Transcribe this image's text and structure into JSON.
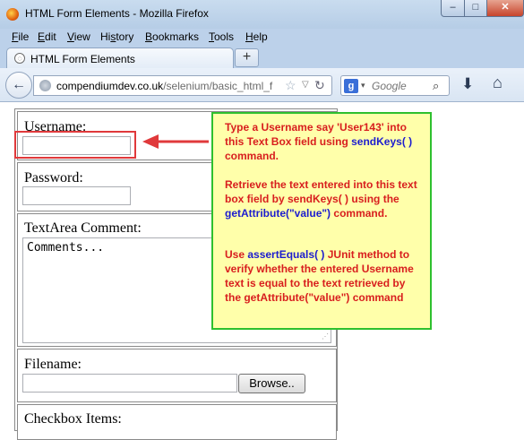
{
  "window": {
    "title": "HTML Form Elements - Mozilla Firefox",
    "min_label": "–",
    "max_label": "□",
    "close_label": "✕"
  },
  "menu": {
    "items": [
      {
        "accel": "F",
        "rest": "ile"
      },
      {
        "accel": "E",
        "rest": "dit"
      },
      {
        "accel": "V",
        "rest": "iew"
      },
      {
        "accel": "",
        "pre": "Hi",
        "accel2": "s",
        "rest": "tory"
      },
      {
        "accel": "B",
        "rest": "ookmarks"
      },
      {
        "accel": "T",
        "rest": "ools"
      },
      {
        "accel": "H",
        "rest": "elp"
      }
    ]
  },
  "tabs": {
    "active_title": "HTML Form Elements",
    "new_tab_label": "+"
  },
  "nav": {
    "back_icon": "←",
    "url_domain": "compendiumdev.co.uk",
    "url_path": "/selenium/basic_html_f",
    "star_icon": "☆",
    "dropdown_icon": "▽",
    "reload_icon": "↻",
    "search_engine_icon": "g",
    "search_dropdown_icon": "▾",
    "search_placeholder": "Google",
    "search_icon": "⌕",
    "download_icon": "⬇",
    "home_icon": "⌂"
  },
  "form": {
    "username_label": "Username:",
    "username_value": "",
    "password_label": "Password:",
    "password_value": "",
    "textarea_label": "TextArea Comment:",
    "textarea_value": "Comments...",
    "filename_label": "Filename:",
    "filename_value": "",
    "browse_label": "Browse..",
    "checkbox_label": "Checkbox Items:"
  },
  "callout": {
    "para1_a": "Type a Username say 'User143' into this Text Box field using ",
    "para1_kw": "sendKeys( )",
    "para1_b": " command.",
    "para2_a": "Retrieve the text entered into this text box field by sendKeys( ) using the ",
    "para2_kw": "getAttribute(\"value\")",
    "para2_b": " command.",
    "para3_a": "Use ",
    "para3_kw": "assertEquals( )",
    "para3_b": " JUnit method to verify whether the entered Username text is equal to the text retrieved by the getAttribute(\"value\") command"
  },
  "colors": {
    "callout_bg": "#ffffaa",
    "callout_border": "#2ec02e",
    "callout_text": "#d81e1e",
    "keyword_text": "#1c1ccf",
    "highlight_red": "#e0393b"
  }
}
